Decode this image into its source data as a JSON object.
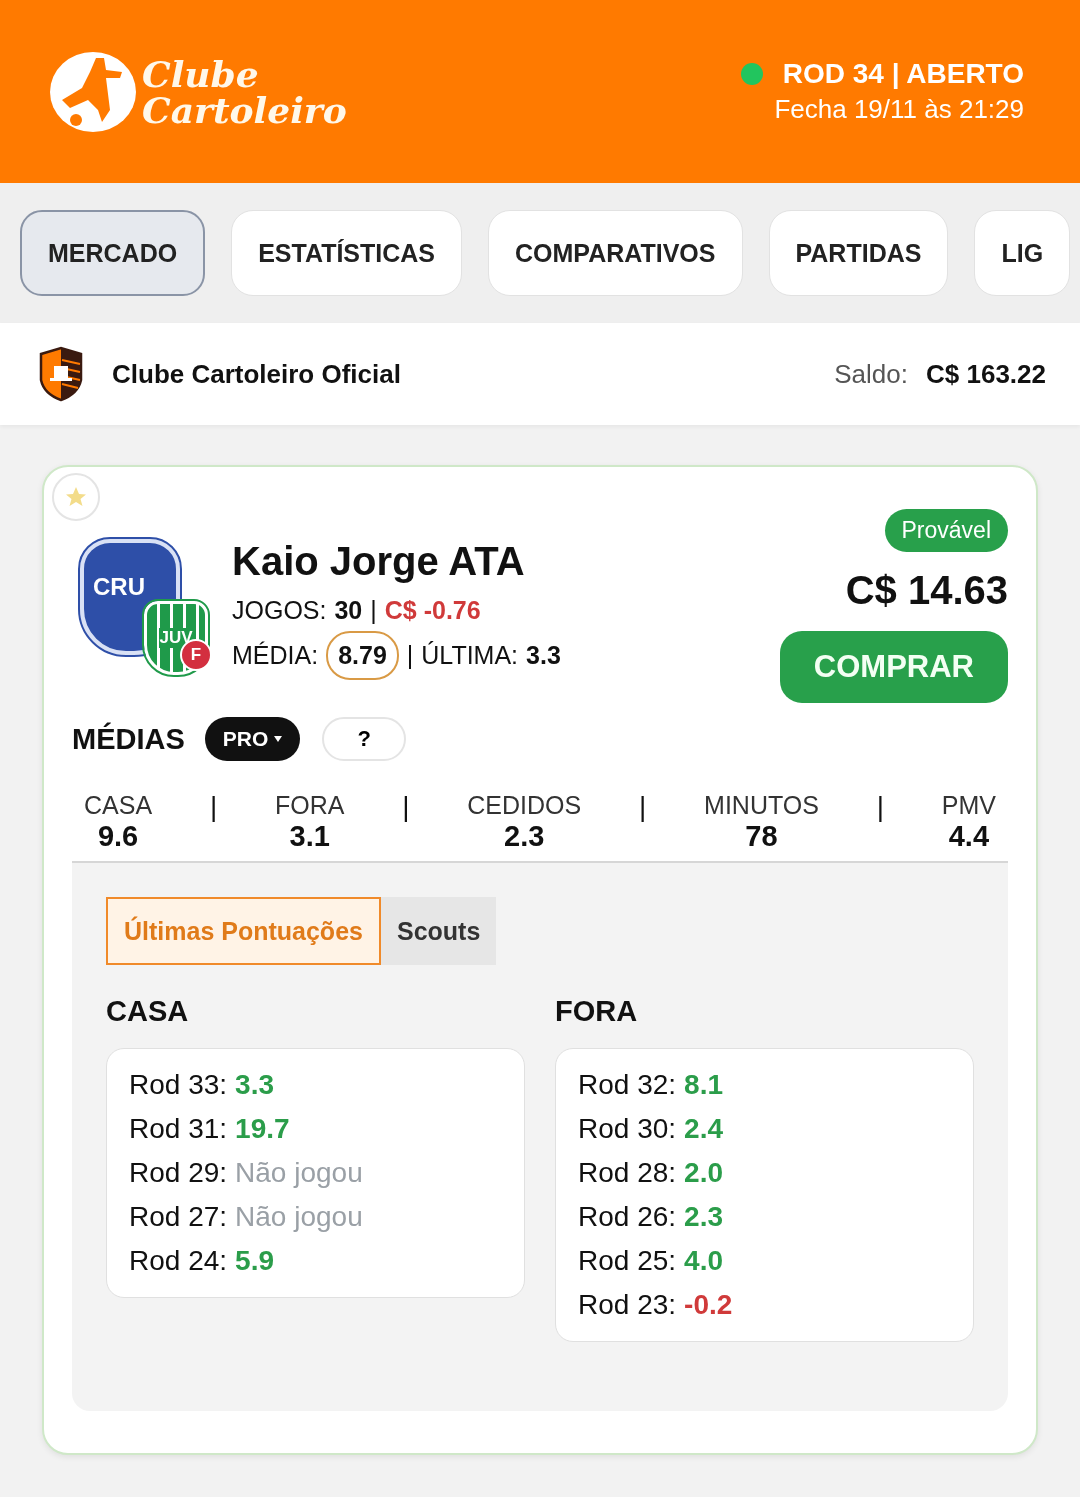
{
  "header": {
    "logo_lines": [
      "Clube",
      "Cartoleiro"
    ],
    "round": {
      "open": true,
      "status": "ROD 34 | ABERTO",
      "closes": "Fecha 19/11 às 21:29"
    }
  },
  "nav_tabs": [
    {
      "label": "MERCADO",
      "selected": true
    },
    {
      "label": "ESTATÍSTICAS",
      "selected": false
    },
    {
      "label": "COMPARATIVOS",
      "selected": false
    },
    {
      "label": "PARTIDAS",
      "selected": false
    },
    {
      "label": "LIG",
      "selected": false
    }
  ],
  "account": {
    "team_name": "Clube Cartoleiro Oficial",
    "balance_label": "Saldo:",
    "balance": "C$ 163.22"
  },
  "player": {
    "favorite": false,
    "club": "CRU",
    "opponent": "JUV",
    "side": "F",
    "name": "Kaio Jorge ATA",
    "games_label": "JOGOS:",
    "games": "30",
    "separator": "|",
    "price_change": "C$ -0.76",
    "price_change_negative": true,
    "average_label": "MÉDIA:",
    "average": "8.79",
    "last_label": "ÚLTIMA:",
    "last": "3.3",
    "status": "Provável",
    "price": "C$ 14.63",
    "buy": "COMPRAR"
  },
  "averages": {
    "title": "MÉDIAS",
    "plan": "PRO",
    "help": "?",
    "separator": "|",
    "stats": [
      {
        "label": "CASA",
        "value": "9.6"
      },
      {
        "label": "FORA",
        "value": "3.1"
      },
      {
        "label": "CEDIDOS",
        "value": "2.3"
      },
      {
        "label": "MINUTOS",
        "value": "78"
      },
      {
        "label": "PMV",
        "value": "4.4"
      }
    ]
  },
  "score_tabs": [
    {
      "label": "Últimas Pontuações",
      "selected": true
    },
    {
      "label": "Scouts",
      "selected": false
    }
  ],
  "score_columns": [
    {
      "title": "CASA",
      "rows": [
        {
          "round": "Rod 33:",
          "score": "3.3",
          "kind": "positive"
        },
        {
          "round": "Rod 31:",
          "score": "19.7",
          "kind": "positive"
        },
        {
          "round": "Rod 29:",
          "score": "Não jogou",
          "kind": "absent"
        },
        {
          "round": "Rod 27:",
          "score": "Não jogou",
          "kind": "absent"
        },
        {
          "round": "Rod 24:",
          "score": "5.9",
          "kind": "positive"
        }
      ]
    },
    {
      "title": "FORA",
      "rows": [
        {
          "round": "Rod 32:",
          "score": "8.1",
          "kind": "positive"
        },
        {
          "round": "Rod 30:",
          "score": "2.4",
          "kind": "positive"
        },
        {
          "round": "Rod 28:",
          "score": "2.0",
          "kind": "positive"
        },
        {
          "round": "Rod 26:",
          "score": "2.3",
          "kind": "positive"
        },
        {
          "round": "Rod 25:",
          "score": "4.0",
          "kind": "positive"
        },
        {
          "round": "Rod 23:",
          "score": "-0.2",
          "kind": "negative"
        }
      ]
    }
  ]
}
